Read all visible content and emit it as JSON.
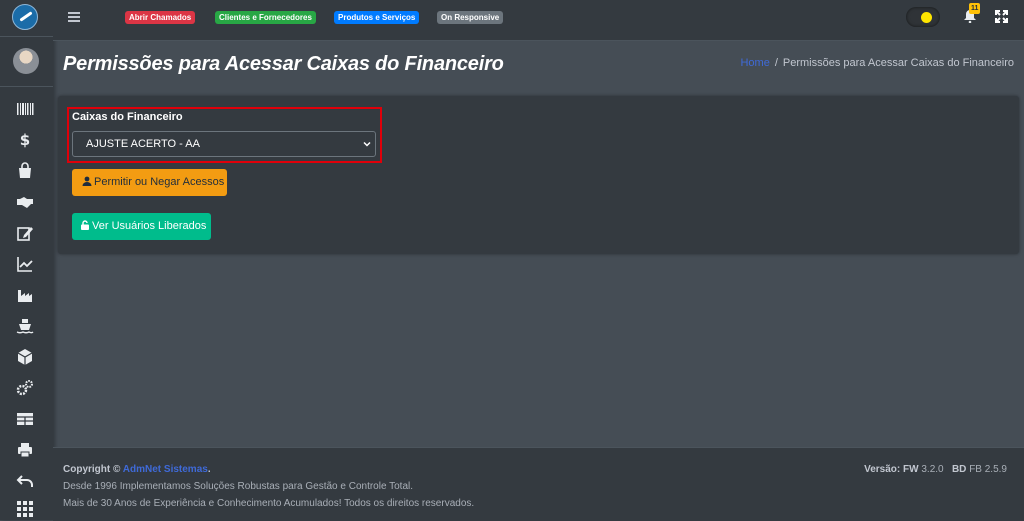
{
  "navbar": {
    "badges": [
      "Abrir Chamados",
      "Clientes e Fornecedores",
      "Produtos e Serviços",
      "On Responsive"
    ],
    "notification_count": "11"
  },
  "header": {
    "title": "Permissões para Acessar Caixas do Financeiro",
    "breadcrumb_home": "Home",
    "breadcrumb_separator": "/",
    "breadcrumb_current": "Permissões para Acessar Caixas do Financeiro"
  },
  "form": {
    "label": "Caixas do Financeiro",
    "selected_option": "AJUSTE ACERTO - AA",
    "permit_button": "Permitir ou Negar Acessos",
    "view_users_button": "Ver Usuários Liberados"
  },
  "footer": {
    "copyright_prefix": "Copyright ©",
    "brand": "AdmNet Sistemas",
    "copyright_suffix": ".",
    "line2": "Desde 1996 Implementamos Soluções Robustas para Gestão e Controle Total.",
    "line3": "Mais de 30 Anos de Experiência e Conhecimento Acumulados! Todos os direitos reservados.",
    "version_label": "Versão:",
    "fw_label": "FW",
    "fw_version": "3.2.0",
    "bd_label": "BD",
    "bd_version": "FB 2.5.9"
  },
  "colors": {
    "background": "#454d55",
    "panel": "#343a40",
    "warning": "#f39c12",
    "success": "#00bc8c",
    "highlight": "#e0000a",
    "link": "#3f6ad8"
  },
  "icons": {
    "sidebar": [
      "barcode-icon",
      "dollar-icon",
      "shopping-bag-icon",
      "handshake-icon",
      "edit-icon",
      "chart-line-icon",
      "industry-icon",
      "ship-icon",
      "cube-icon",
      "cogs-icon",
      "table-icon",
      "print-icon",
      "undo-icon",
      "grid-icon"
    ]
  }
}
